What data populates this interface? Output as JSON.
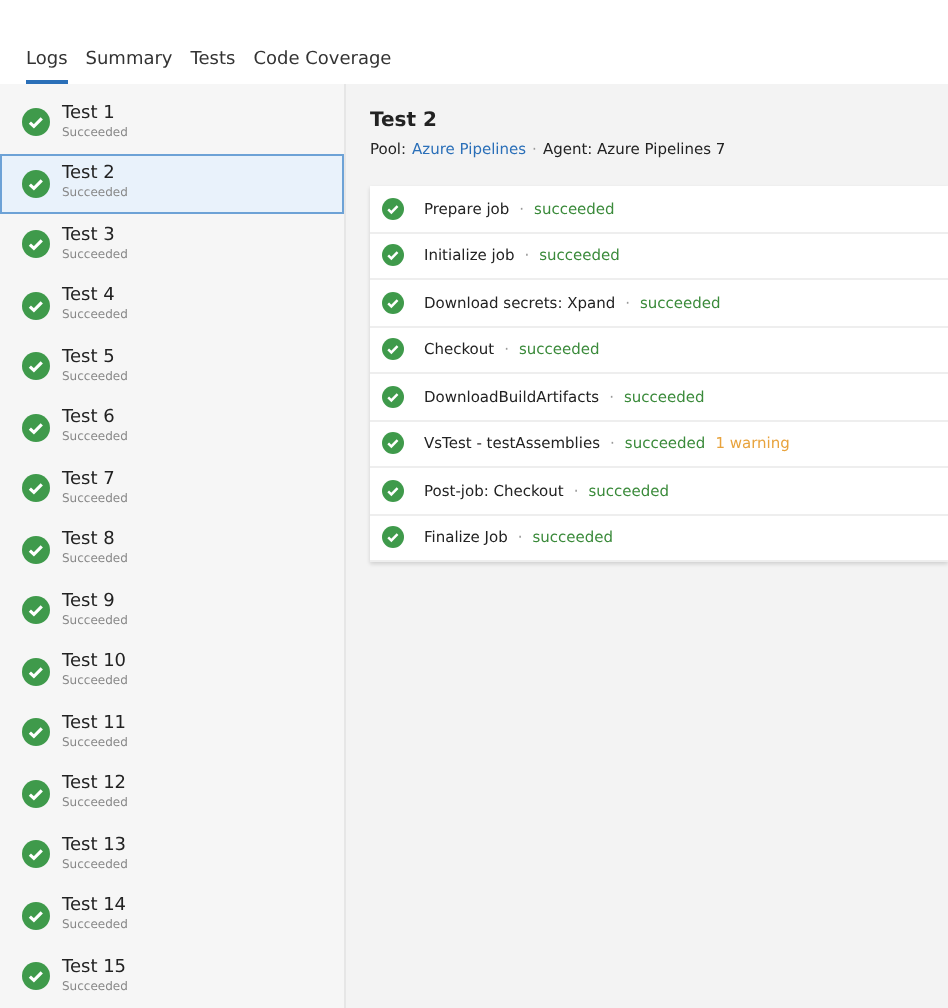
{
  "tabs": [
    {
      "label": "Logs",
      "selected": true
    },
    {
      "label": "Summary",
      "selected": false
    },
    {
      "label": "Tests",
      "selected": false
    },
    {
      "label": "Code Coverage",
      "selected": false
    }
  ],
  "jobs": [
    {
      "name": "Test 1",
      "status": "Succeeded",
      "selected": false
    },
    {
      "name": "Test 2",
      "status": "Succeeded",
      "selected": true
    },
    {
      "name": "Test 3",
      "status": "Succeeded",
      "selected": false
    },
    {
      "name": "Test 4",
      "status": "Succeeded",
      "selected": false
    },
    {
      "name": "Test 5",
      "status": "Succeeded",
      "selected": false
    },
    {
      "name": "Test 6",
      "status": "Succeeded",
      "selected": false
    },
    {
      "name": "Test 7",
      "status": "Succeeded",
      "selected": false
    },
    {
      "name": "Test 8",
      "status": "Succeeded",
      "selected": false
    },
    {
      "name": "Test 9",
      "status": "Succeeded",
      "selected": false
    },
    {
      "name": "Test 10",
      "status": "Succeeded",
      "selected": false
    },
    {
      "name": "Test 11",
      "status": "Succeeded",
      "selected": false
    },
    {
      "name": "Test 12",
      "status": "Succeeded",
      "selected": false
    },
    {
      "name": "Test 13",
      "status": "Succeeded",
      "selected": false
    },
    {
      "name": "Test 14",
      "status": "Succeeded",
      "selected": false
    },
    {
      "name": "Test 15",
      "status": "Succeeded",
      "selected": false
    }
  ],
  "detail": {
    "title": "Test 2",
    "pool_label": "Pool:",
    "pool": "Azure Pipelines",
    "separator": "·",
    "agent": "Agent: Azure Pipelines 7"
  },
  "steps": [
    {
      "name": "Prepare job",
      "status": "succeeded"
    },
    {
      "name": "Initialize job",
      "status": "succeeded"
    },
    {
      "name": "Download secrets: Xpand",
      "status": "succeeded"
    },
    {
      "name": "Checkout",
      "status": "succeeded"
    },
    {
      "name": "DownloadBuildArtifacts",
      "status": "succeeded"
    },
    {
      "name": "VsTest - testAssemblies",
      "status": "succeeded",
      "warning": "1 warning"
    },
    {
      "name": "Post-job: Checkout",
      "status": "succeeded"
    },
    {
      "name": "Finalize Job",
      "status": "succeeded"
    }
  ],
  "step_separator": "·"
}
